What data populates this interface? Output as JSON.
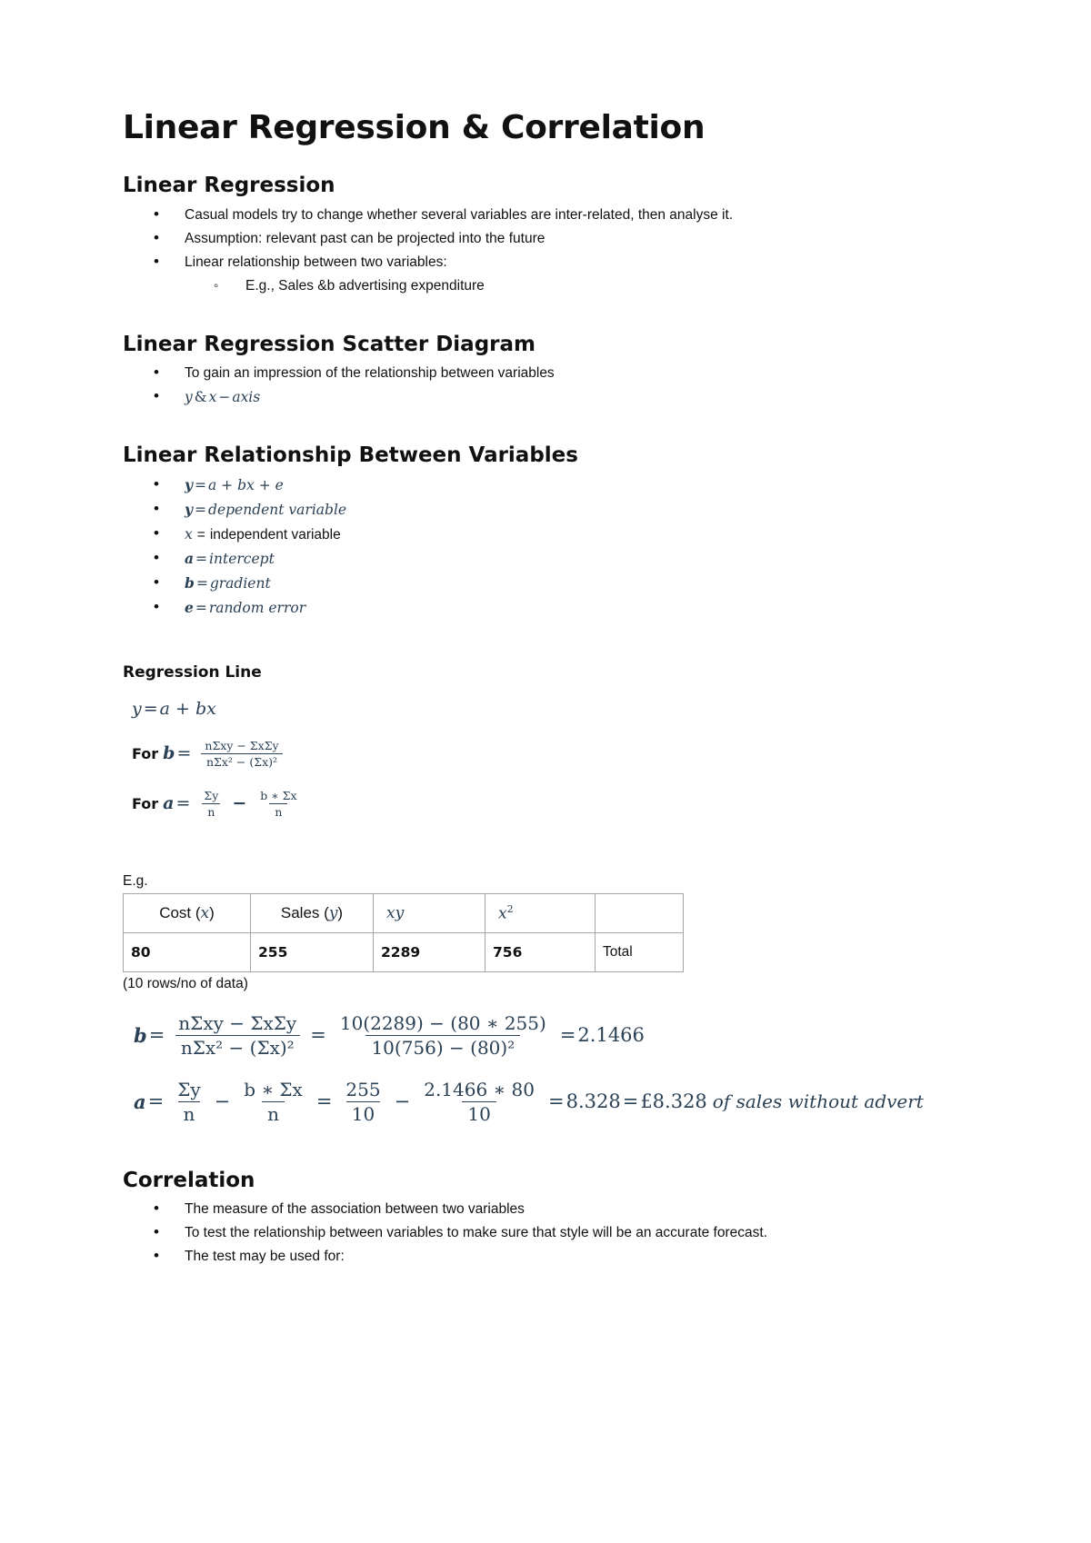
{
  "document": {
    "title": "Linear Regression & Correlation"
  },
  "sections": {
    "linear_regression": {
      "heading": "Linear Regression",
      "bullets": [
        "Casual models try to change whether several variables are inter-related, then analyse it.",
        "Assumption: relevant past can be projected into the future",
        "Linear relationship between two variables:"
      ],
      "sub_bullets": [
        "E.g., Sales &b advertising expenditure"
      ]
    },
    "scatter_diagram": {
      "heading": "Linear Regression Scatter Diagram",
      "bullet_text": "To gain an impression of the relationship between variables",
      "math_bullet": {
        "y": "y",
        "amp": "&",
        "x": "x",
        "minus": "−",
        "axis": "axis"
      }
    },
    "linear_relationship": {
      "heading": "Linear Relationship Between Variables",
      "items": [
        {
          "lhs": "y",
          "eq": "=",
          "rhs": "a + bx + e",
          "style": "math"
        },
        {
          "lhs": "y",
          "eq": "=",
          "rhs": "dependent variable",
          "style": "math"
        },
        {
          "lhs": "x",
          "eq": "=",
          "rhs": "independent variable",
          "style": "mixed"
        },
        {
          "lhs": "a",
          "eq": "=",
          "rhs": "intercept",
          "style": "math"
        },
        {
          "lhs": "b",
          "eq": "=",
          "rhs": "gradient",
          "style": "math"
        },
        {
          "lhs": "e",
          "eq": "=",
          "rhs": "random error",
          "style": "math"
        }
      ]
    },
    "regression_line": {
      "heading": "Regression Line",
      "equation": {
        "lhs": "y",
        "eq": "=",
        "rhs": "a + bx"
      },
      "for_b": {
        "label": "For",
        "var": "b",
        "eq": "=",
        "numerator": "nΣxy − ΣxΣy",
        "denominator": "nΣx² − (Σx)²"
      },
      "for_a": {
        "label": "For",
        "var": "a",
        "eq": "=",
        "term1_num": "Σy",
        "term1_den": "n",
        "operator": "−",
        "term2_num": "b ∗ Σx",
        "term2_den": "n"
      }
    },
    "example": {
      "eg_label": "E.g.",
      "table": {
        "headers": [
          "Cost (x)",
          "Sales (y)",
          "xy",
          "x²",
          ""
        ],
        "rows": [
          [
            "80",
            "255",
            "2289",
            "756",
            "Total"
          ]
        ]
      },
      "note": "(10 rows/no of data)",
      "b_calculation": {
        "var": "b",
        "eq1": "=",
        "f1_num": "nΣxy − ΣxΣy",
        "f1_den": "nΣx² − (Σx)²",
        "eq2": "=",
        "f2_num": "10(2289) − (80 ∗ 255)",
        "f2_den": "10(756) − (80)²",
        "eq3": "=",
        "result": "2.1466"
      },
      "a_calculation": {
        "var": "a",
        "eq1": "=",
        "f1_num": "Σy",
        "f1_den": "n",
        "op1": "−",
        "f2_num": "b ∗ Σx",
        "f2_den": "n",
        "eq2": "=",
        "f3_num": "255",
        "f3_den": "10",
        "op2": "−",
        "f4_num": "2.1466 ∗ 80",
        "f4_den": "10",
        "eq3": "=",
        "result": "8.328",
        "eq4": "=",
        "result2": "£8.328",
        "tail": "of sales without advert"
      }
    },
    "correlation": {
      "heading": "Correlation",
      "bullets": [
        "The measure of the association between two variables",
        "To test the relationship between variables to make sure that style will be an accurate forecast.",
        "The test may be used for:"
      ]
    }
  },
  "colors": {
    "math_text": "#2b4155",
    "body_text": "#111111",
    "table_border": "#a6a6a6"
  }
}
